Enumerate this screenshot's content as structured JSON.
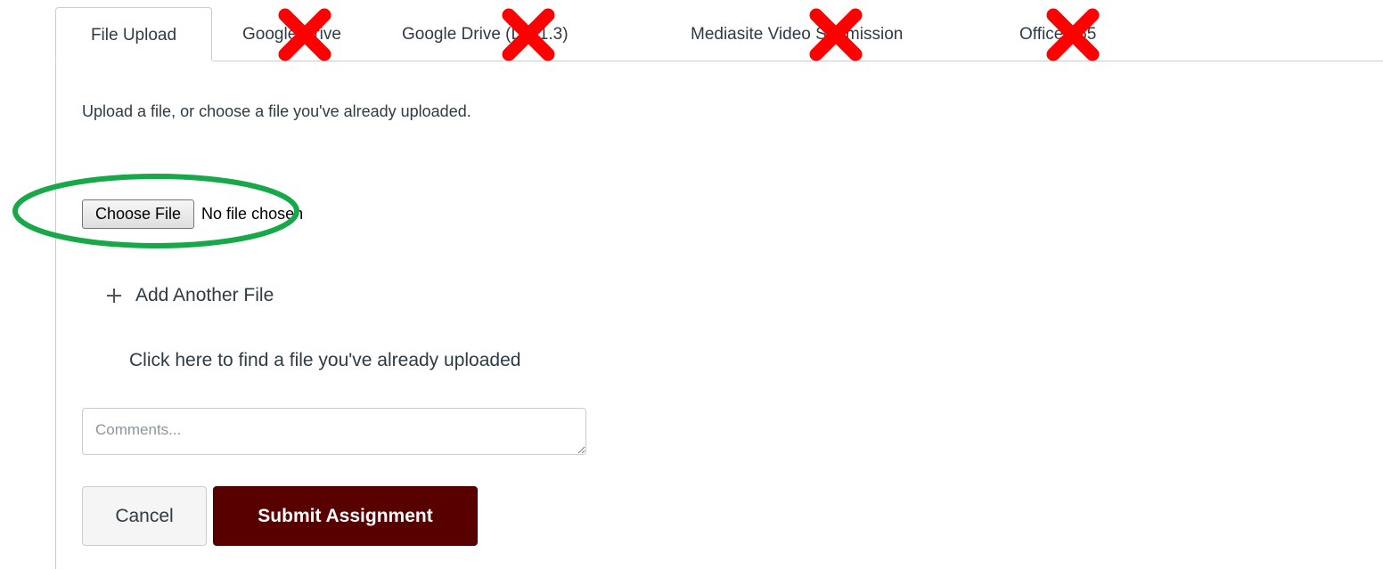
{
  "tabs": [
    {
      "label": "File Upload",
      "active": true
    },
    {
      "label": "Google Drive",
      "active": false,
      "crossed_out": true
    },
    {
      "label": "Google Drive (LTI 1.3)",
      "active": false,
      "crossed_out": true
    },
    {
      "label": "Mediasite Video Submission",
      "active": false,
      "crossed_out": true
    },
    {
      "label": "Office 365",
      "active": false,
      "crossed_out": true
    }
  ],
  "upload": {
    "instructions": "Upload a file, or choose a file you've already uploaded.",
    "choose_file_label": "Choose File",
    "file_status": "No file chosen",
    "add_another_label": "Add Another File",
    "find_uploaded_label": "Click here to find a file you've already uploaded"
  },
  "comments": {
    "placeholder": "Comments...",
    "value": ""
  },
  "actions": {
    "cancel_label": "Cancel",
    "submit_label": "Submit Assignment"
  },
  "annotations": {
    "cross_mark_color": "#ff0000",
    "highlight_color": "#17a84a"
  },
  "colors": {
    "submit_bg": "#580000",
    "text": "#2d3b45",
    "border": "#c7cdd1"
  }
}
